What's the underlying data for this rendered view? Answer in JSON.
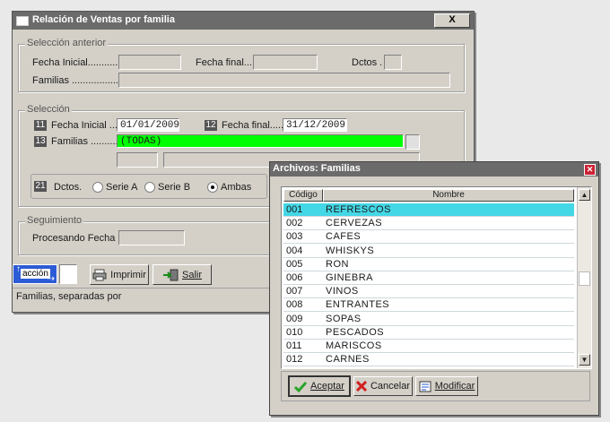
{
  "main_window": {
    "title": "Relación de Ventas por familia",
    "close_label": "X",
    "seleccion_anterior": {
      "legend": "Selección anterior",
      "fecha_inicial_label": "Fecha Inicial............",
      "fecha_final_label": "Fecha final...",
      "dctos_label": "Dctos .",
      "familias_label": "Familias ....................",
      "fecha_inicial_value": "",
      "fecha_final_value": "",
      "dctos_value": "",
      "familias_value": ""
    },
    "seleccion": {
      "legend": "Selección",
      "fecha_inicial_num": "11",
      "fecha_inicial_label": "Fecha Inicial ...",
      "fecha_inicial_value": "01/01/2009",
      "fecha_final_num": "12",
      "fecha_final_label": "Fecha final......",
      "fecha_final_value": "31/12/2009",
      "familias_num": "13",
      "familias_label": "Familias ..........",
      "familias_value": "(TODAS)",
      "dctos_num": "21",
      "dctos_label": "Dctos.",
      "radio_options": [
        "Serie A",
        "Serie B",
        "Ambas"
      ],
      "radio_selected": "Ambas"
    },
    "seguimiento": {
      "legend": "Seguimiento",
      "procesando_label": "Procesando Fecha",
      "procesando_value": ""
    },
    "toolbar": {
      "accion_label": "acción",
      "imprimir_label": "Imprimir",
      "salir_label": "Salir"
    },
    "status_text": "Familias, separadas por"
  },
  "dialog": {
    "title": "Archivos: Familias",
    "columns": [
      "Código",
      "Nombre"
    ],
    "rows": [
      {
        "code": "001",
        "name": "REFRESCOS"
      },
      {
        "code": "002",
        "name": "CERVEZAS"
      },
      {
        "code": "003",
        "name": "CAFES"
      },
      {
        "code": "004",
        "name": "WHISKYS"
      },
      {
        "code": "005",
        "name": "RON"
      },
      {
        "code": "006",
        "name": "GINEBRA"
      },
      {
        "code": "007",
        "name": "VINOS"
      },
      {
        "code": "008",
        "name": "ENTRANTES"
      },
      {
        "code": "009",
        "name": "SOPAS"
      },
      {
        "code": "010",
        "name": "PESCADOS"
      },
      {
        "code": "011",
        "name": "MARISCOS"
      },
      {
        "code": "012",
        "name": "CARNES"
      }
    ],
    "selected_row": 0,
    "buttons": {
      "aceptar": "Aceptar",
      "cancelar": "Cancelar",
      "modificar": "Modificar"
    }
  },
  "colors": {
    "selection_green": "#00ff00",
    "row_highlight": "#44d7e6",
    "title_bar": "#6b6b6b"
  }
}
